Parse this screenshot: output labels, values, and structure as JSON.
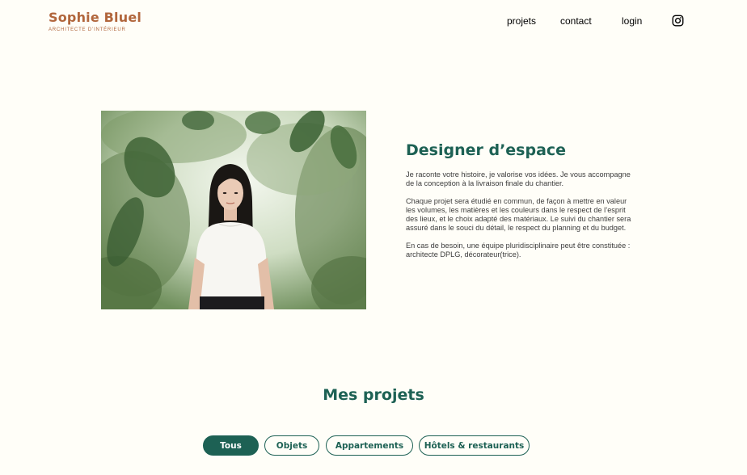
{
  "header": {
    "logo_title": "Sophie Bluel",
    "logo_subtitle": "ARCHITECTE D’INTÉRIEUR",
    "nav": {
      "projets": "projets",
      "contact": "contact",
      "login": "login",
      "instagram_icon": "instagram-icon"
    }
  },
  "introduction": {
    "title": "Designer d’espace",
    "paragraphs": [
      "Je raconte votre histoire, je valorise vos idées. Je vous accompagne de la conception à la livraison finale du chantier.",
      "Chaque projet sera étudié en commun, de façon à mettre en valeur les volumes, les matières et les couleurs dans le respect de l’esprit des lieux, et le choix adapté des matériaux. Le suivi du chantier sera assuré dans le souci du détail, le respect du planning et du budget.",
      "En cas de besoin, une équipe pluridisciplinaire peut être constituée : architecte DPLG, décorateur(trice)."
    ]
  },
  "portfolio": {
    "title": "Mes projets",
    "filters": [
      "Tous",
      "Objets",
      "Appartements",
      "Hôtels & restaurants"
    ],
    "active_filter": "Tous"
  },
  "colors": {
    "brand": "#B1663C",
    "accent": "#1D6154",
    "background": "#FFFEF8"
  }
}
